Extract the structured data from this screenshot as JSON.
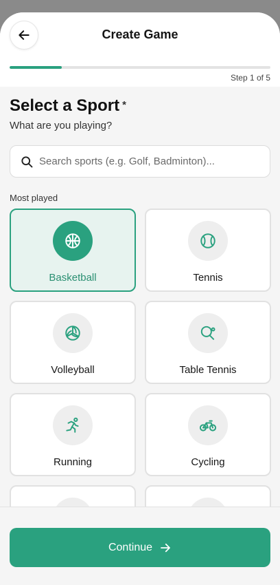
{
  "header": {
    "title": "Create Game"
  },
  "progress": {
    "step_text": "Step 1 of 5",
    "fraction": 0.2,
    "color": "#2aa17f"
  },
  "main": {
    "heading": "Select a Sport",
    "required_mark": "*",
    "subheading": "What are you playing?",
    "search": {
      "placeholder": "Search sports (e.g. Golf, Badminton)...",
      "value": ""
    },
    "section_label": "Most played",
    "sports": [
      {
        "label": "Basketball",
        "icon": "basketball-icon",
        "selected": true
      },
      {
        "label": "Tennis",
        "icon": "tennis-ball-icon",
        "selected": false
      },
      {
        "label": "Volleyball",
        "icon": "volleyball-icon",
        "selected": false
      },
      {
        "label": "Table Tennis",
        "icon": "table-tennis-icon",
        "selected": false
      },
      {
        "label": "Running",
        "icon": "running-icon",
        "selected": false
      },
      {
        "label": "Cycling",
        "icon": "bicycle-icon",
        "selected": false
      }
    ]
  },
  "footer": {
    "continue_label": "Continue"
  },
  "colors": {
    "accent": "#2aa17f",
    "selected_bg": "#e7f3ef"
  }
}
